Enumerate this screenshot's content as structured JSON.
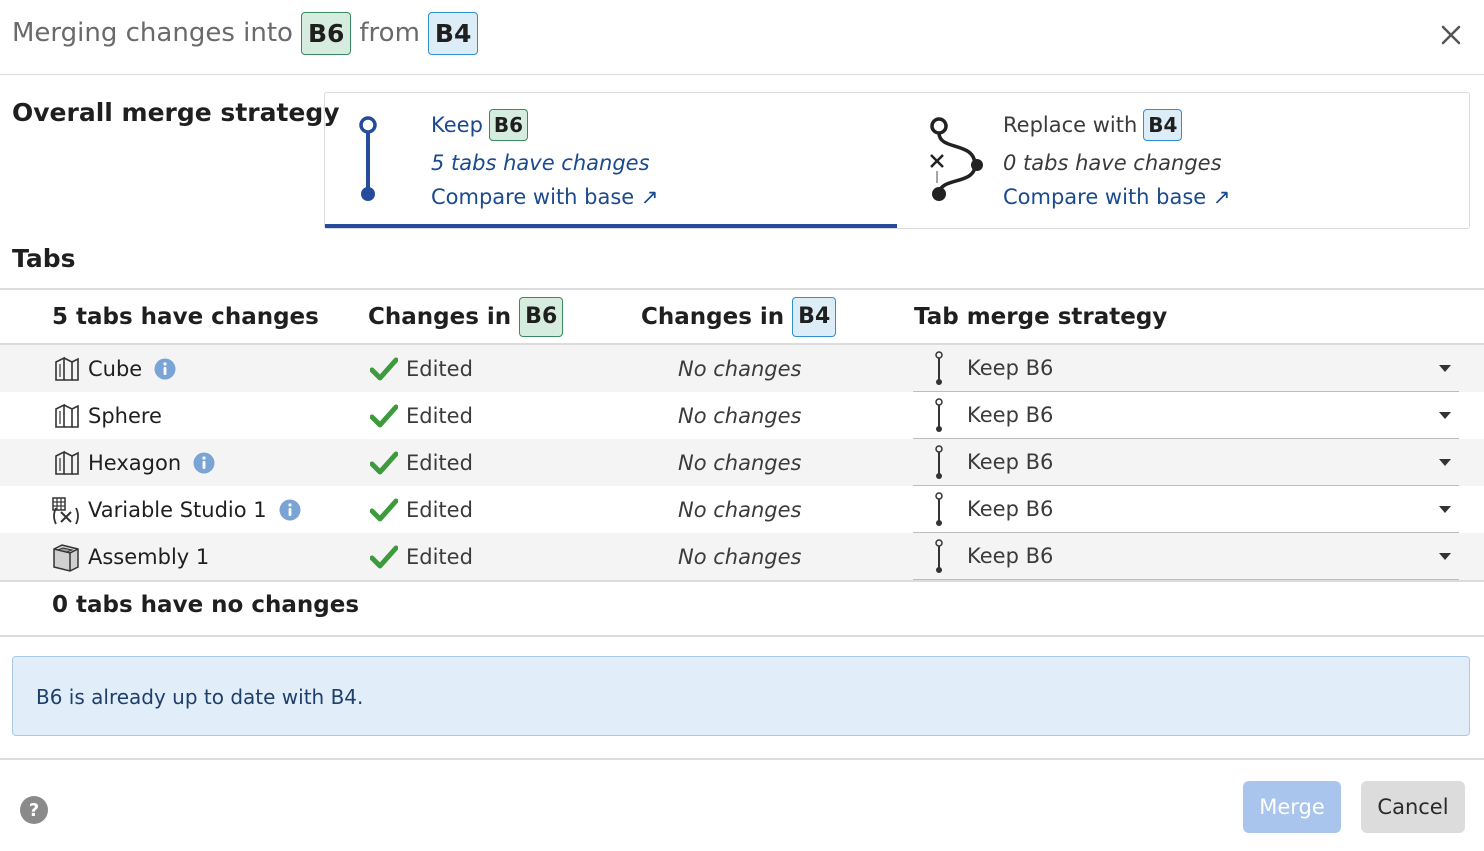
{
  "dialog": {
    "title_prefix": "Merging changes into",
    "target_branch": "B6",
    "title_middle": "from",
    "source_branch": "B4",
    "close_icon": "close-icon"
  },
  "overall": {
    "title": "Overall merge strategy",
    "keep": {
      "label": "Keep",
      "branch": "B6",
      "summary": "5 tabs have changes",
      "compare": "Compare with base ↗",
      "selected": true
    },
    "replace": {
      "label": "Replace with",
      "branch": "B4",
      "summary": "0 tabs have changes",
      "compare": "Compare with base ↗",
      "selected": false
    }
  },
  "tabs": {
    "title": "Tabs",
    "columns": {
      "changed_count": "5 tabs have changes",
      "changes_in_prefix": "Changes in",
      "col2_branch": "B6",
      "col3_branch": "B4",
      "strategy": "Tab merge strategy"
    },
    "rows": [
      {
        "name": "Cube",
        "icon": "part-studio-icon",
        "info": true,
        "target_change": "Edited",
        "source_change": "No changes",
        "strategy": "Keep B6"
      },
      {
        "name": "Sphere",
        "icon": "part-studio-icon",
        "info": false,
        "target_change": "Edited",
        "source_change": "No changes",
        "strategy": "Keep B6"
      },
      {
        "name": "Hexagon",
        "icon": "part-studio-icon",
        "info": true,
        "target_change": "Edited",
        "source_change": "No changes",
        "strategy": "Keep B6"
      },
      {
        "name": "Variable Studio 1",
        "icon": "variable-studio-icon",
        "info": true,
        "target_change": "Edited",
        "source_change": "No changes",
        "strategy": "Keep B6"
      },
      {
        "name": "Assembly 1",
        "icon": "assembly-icon",
        "info": false,
        "target_change": "Edited",
        "source_change": "No changes",
        "strategy": "Keep B6"
      }
    ],
    "unchanged_count": "0 tabs have no changes"
  },
  "notice": {
    "text": "B6 is already up to date with B4."
  },
  "footer": {
    "help_icon": "help-icon",
    "merge": "Merge",
    "cancel": "Cancel",
    "merge_enabled": false
  },
  "colors": {
    "link_blue": "#1a4a8f",
    "selected_underline": "#244b9c",
    "check_green": "#3d9a3d",
    "info_blue": "#7aa3d6",
    "notice_bg": "#e1eef9",
    "merge_disabled": "#a9c5ed"
  }
}
